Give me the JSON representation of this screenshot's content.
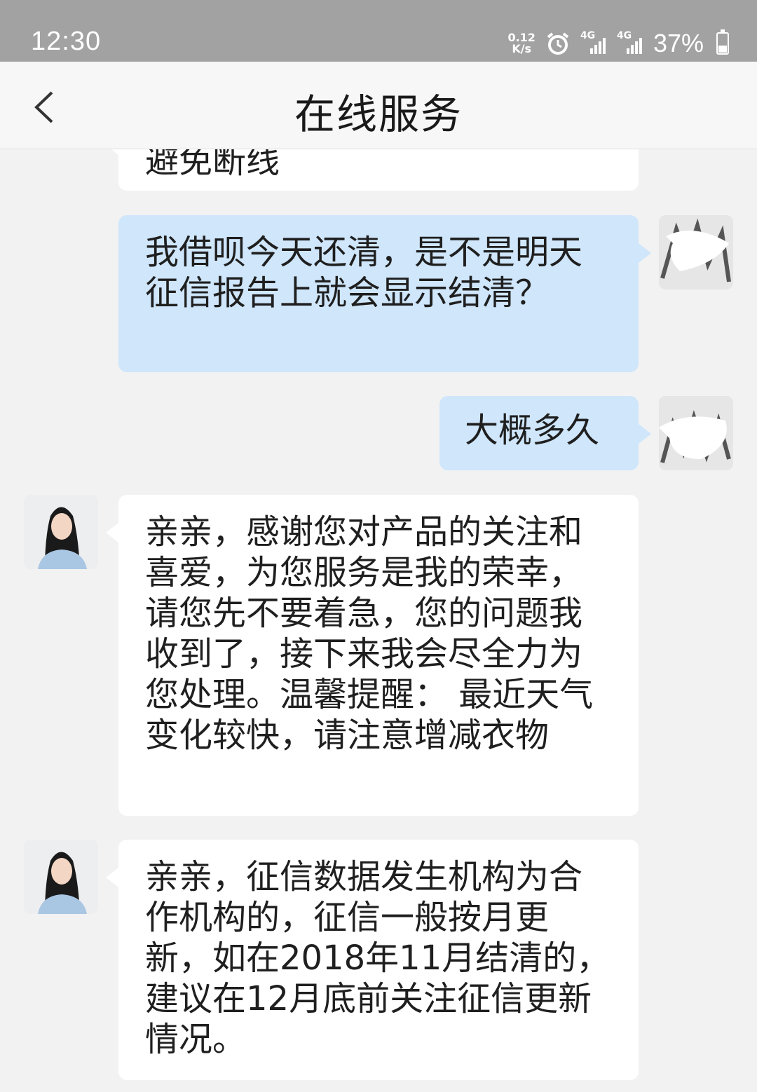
{
  "status_bar": {
    "time": "12:30",
    "speed_value": "0.12",
    "speed_unit": "K/s",
    "network_1": "4G",
    "network_2": "4G",
    "battery_percent": "37%",
    "battery_level": 0.37
  },
  "header": {
    "title": "在线服务",
    "back_icon": "chevron-left-icon"
  },
  "messages": [
    {
      "side": "left",
      "text": "避免断线",
      "partial": true
    },
    {
      "side": "right",
      "text": "我借呗今天还清，是不是明天征信报告上就会显示结清？"
    },
    {
      "side": "right",
      "text": "大概多久"
    },
    {
      "side": "left",
      "text": "亲亲，感谢您对产品的关注和喜爱，为您服务是我的荣幸，请您先不要着急，您的问题我收到了，接下来我会尽全力为您处理。温馨提醒： 最近天气变化较快，请注意增减衣物"
    },
    {
      "side": "left",
      "text": "亲亲，征信数据发生机构为合作机构的，征信一般按月更新，如在2018年11月结清的，建议在12月底前关注征信更新情况。"
    }
  ]
}
